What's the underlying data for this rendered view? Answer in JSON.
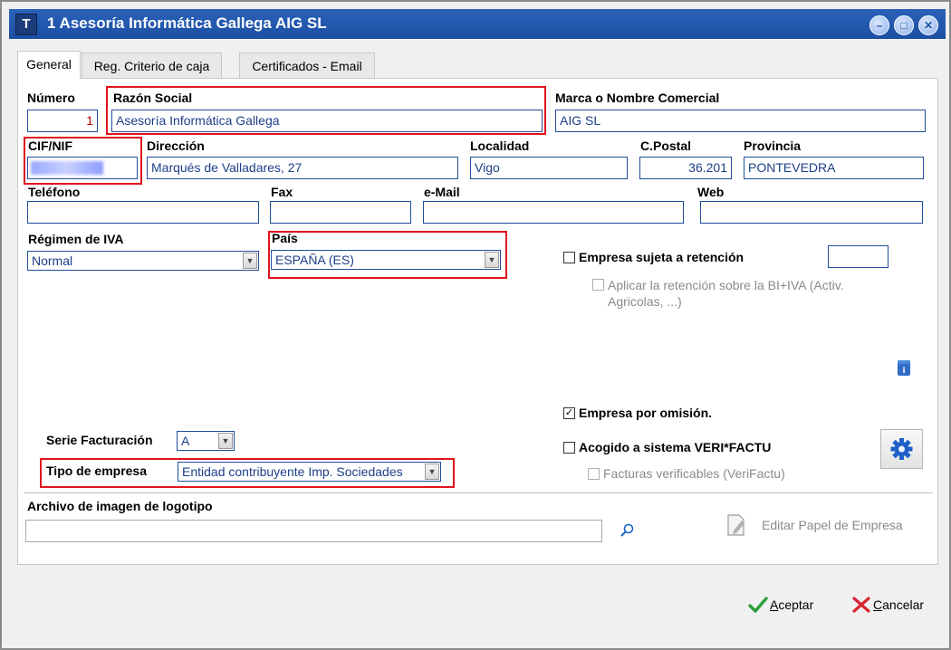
{
  "window": {
    "title": "1 Asesoría Informática Gallega  AIG SL",
    "app_icon": "T"
  },
  "tabs": [
    "General",
    "Reg. Criterio de caja",
    "Certificados - Email"
  ],
  "form": {
    "numero": {
      "label": "Número",
      "value": "1"
    },
    "razon_social": {
      "label": "Razón Social",
      "value": "Asesoría Informática Gallega"
    },
    "marca": {
      "label": "Marca o Nombre Comercial",
      "value": "AIG SL"
    },
    "cif": {
      "label": "CIF/NIF"
    },
    "direccion": {
      "label": "Dirección",
      "value": "Marqués de Valladares, 27"
    },
    "localidad": {
      "label": "Localidad",
      "value": "Vigo"
    },
    "cpostal": {
      "label": "C.Postal",
      "value": "36.201"
    },
    "provincia": {
      "label": "Provincia",
      "value": "PONTEVEDRA"
    },
    "telefono": {
      "label": "Teléfono",
      "value": ""
    },
    "fax": {
      "label": "Fax",
      "value": ""
    },
    "email": {
      "label": "e-Mail",
      "value": ""
    },
    "web": {
      "label": "Web",
      "value": ""
    },
    "regimen_iva": {
      "label": "Régimen de IVA",
      "value": "Normal"
    },
    "pais": {
      "label": "País",
      "value": "ESPAÑA  (ES)"
    },
    "retencion": {
      "label": "Empresa sujeta a retención",
      "checked": false,
      "value": ""
    },
    "aplicar_retencion": {
      "label": "Aplicar la retención sobre la BI+IVA (Activ. Agricolas, ...)",
      "checked": false
    },
    "empresa_omision": {
      "label": "Empresa por omisión.",
      "checked": true
    },
    "verifactu": {
      "label": "Acogido a sistema VERI*FACTU",
      "checked": false
    },
    "facturas_verificables": {
      "label": "Facturas verificables (VeriFactu)",
      "checked": false
    },
    "serie": {
      "label": "Serie Facturación",
      "value": "A"
    },
    "tipo_empresa": {
      "label": "Tipo de empresa",
      "value": "Entidad contribuyente Imp. Sociedades"
    },
    "logotipo": {
      "label": "Archivo de imagen de logotipo",
      "value": ""
    },
    "editar_papel": "Editar Papel de Empresa"
  },
  "buttons": {
    "aceptar": {
      "hotkey": "A",
      "rest": "ceptar"
    },
    "cancelar": {
      "hotkey": "C",
      "rest": "ancelar"
    }
  },
  "colors": {
    "titlebar": "#1c4fa3",
    "field_border": "#1f4e9c",
    "field_text": "#1d3e88",
    "highlight": "#e0141e"
  }
}
